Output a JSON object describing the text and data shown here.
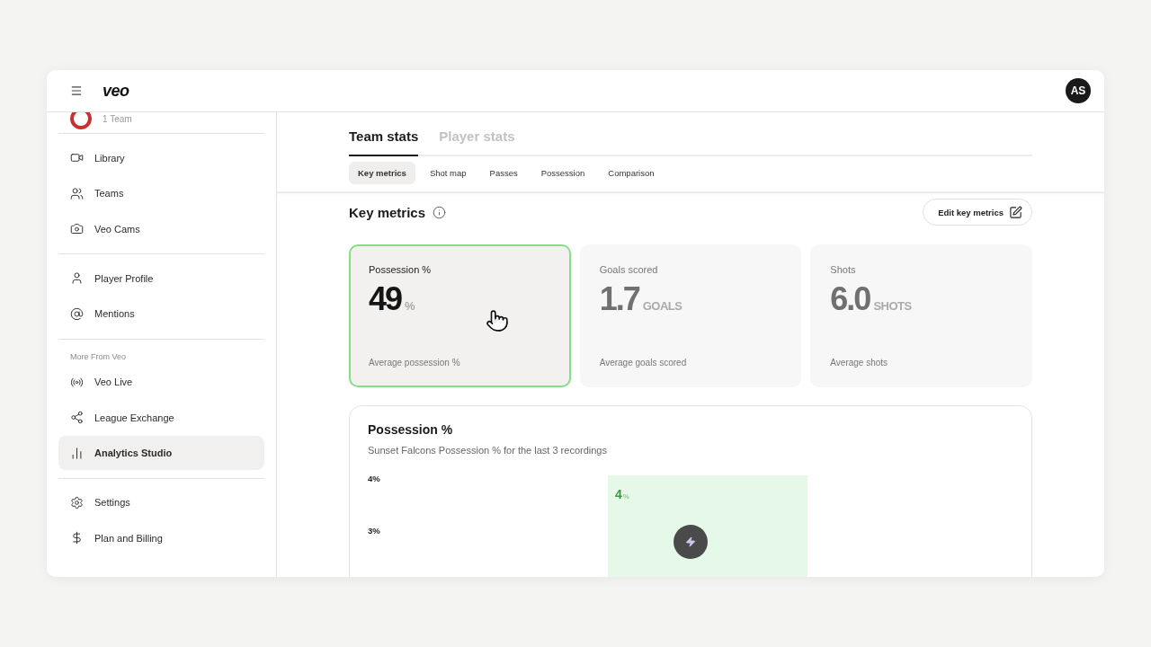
{
  "header": {
    "logo": "veo",
    "avatar": "AS"
  },
  "sidebar": {
    "team": {
      "subtitle": "1 Team"
    },
    "sections": [
      {
        "items": [
          {
            "label": "Library",
            "selected": false
          },
          {
            "label": "Teams",
            "selected": false
          },
          {
            "label": "Veo Cams",
            "selected": false
          }
        ]
      },
      {
        "items": [
          {
            "label": "Player Profile",
            "selected": false
          },
          {
            "label": "Mentions",
            "selected": false
          }
        ]
      },
      {
        "heading": "More From Veo",
        "items": [
          {
            "label": "Veo Live",
            "selected": false
          },
          {
            "label": "League Exchange",
            "selected": false
          },
          {
            "label": "Analytics Studio",
            "selected": true
          }
        ]
      },
      {
        "items": [
          {
            "label": "Settings",
            "selected": false
          },
          {
            "label": "Plan and Billing",
            "selected": false
          }
        ]
      }
    ]
  },
  "tabs": [
    {
      "label": "Team stats",
      "selected": true
    },
    {
      "label": "Player stats",
      "selected": false
    }
  ],
  "subtabs": [
    {
      "label": "Key metrics",
      "selected": true
    },
    {
      "label": "Shot map",
      "selected": false
    },
    {
      "label": "Passes",
      "selected": false
    },
    {
      "label": "Possession",
      "selected": false
    },
    {
      "label": "Comparison",
      "selected": false
    }
  ],
  "key_metrics": {
    "title": "Key metrics",
    "edit_button": "Edit key metrics",
    "cards": [
      {
        "label": "Possession %",
        "value": "49",
        "unit": "%",
        "caption": "Average possession %",
        "selected": true
      },
      {
        "label": "Goals scored",
        "value": "1.7",
        "unit": "GOALS",
        "caption": "Average goals scored",
        "selected": false
      },
      {
        "label": "Shots",
        "value": "6.0",
        "unit": "SHOTS",
        "caption": "Average shots",
        "selected": false
      }
    ]
  },
  "chart_card": {
    "title": "Possession %",
    "subtitle": "Sunset Falcons Possession % for the last 3 recordings",
    "y_axis_labels": [
      "4%",
      "3%"
    ],
    "bar_label": {
      "value": "4",
      "unit": "%"
    }
  }
}
